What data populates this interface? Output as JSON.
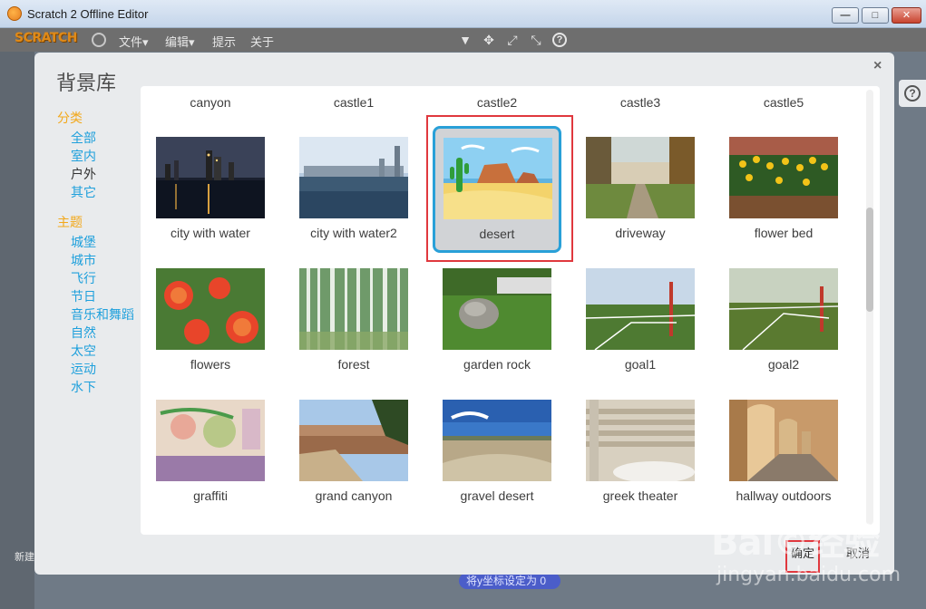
{
  "window": {
    "title": "Scratch 2 Offline Editor",
    "minimize": "—",
    "maximize": "□",
    "close": "✕"
  },
  "menubar": {
    "logo": "SCRATCH",
    "file": "文件▾",
    "edit": "编辑▾",
    "tips": "提示",
    "about": "关于",
    "tool_icons": [
      "stamp-icon",
      "cut-icon",
      "grow-icon",
      "shrink-icon",
      "help-icon"
    ]
  },
  "dialog": {
    "title": "背景库",
    "close": "×",
    "category_heading": "分类",
    "categories": [
      "全部",
      "室内",
      "户外",
      "其它"
    ],
    "active_category": "户外",
    "theme_heading": "主题",
    "themes": [
      "城堡",
      "城市",
      "飞行",
      "节日",
      "音乐和舞蹈",
      "自然",
      "太空",
      "运动",
      "水下"
    ],
    "top_row_labels": [
      "canyon",
      "castle1",
      "castle2",
      "castle3",
      "castle5"
    ],
    "items": [
      {
        "label": "city with water",
        "thumb": "city-night"
      },
      {
        "label": "city with water2",
        "thumb": "city-day"
      },
      {
        "label": "desert",
        "thumb": "desert",
        "selected": true
      },
      {
        "label": "driveway",
        "thumb": "driveway"
      },
      {
        "label": "flower bed",
        "thumb": "flowerbed"
      },
      {
        "label": "flowers",
        "thumb": "flowers"
      },
      {
        "label": "forest",
        "thumb": "forest"
      },
      {
        "label": "garden rock",
        "thumb": "rock"
      },
      {
        "label": "goal1",
        "thumb": "goal1"
      },
      {
        "label": "goal2",
        "thumb": "goal2"
      },
      {
        "label": "graffiti",
        "thumb": "graffiti"
      },
      {
        "label": "grand canyon",
        "thumb": "canyon"
      },
      {
        "label": "gravel desert",
        "thumb": "gravel"
      },
      {
        "label": "greek theater",
        "thumb": "theater"
      },
      {
        "label": "hallway outdoors",
        "thumb": "hallway"
      }
    ],
    "ok_label": "确定",
    "cancel_label": "取消"
  },
  "background": {
    "pill": "将y坐标设定为 0",
    "new_label": "新建"
  },
  "watermark": {
    "main": "Bai©经验",
    "sub": "jingyan.baidu.com"
  },
  "colors": {
    "accent_orange": "#f2a81b",
    "link_blue": "#1fa0dc",
    "selection_blue": "#29a0d8",
    "annotation_red": "#e0383e"
  }
}
